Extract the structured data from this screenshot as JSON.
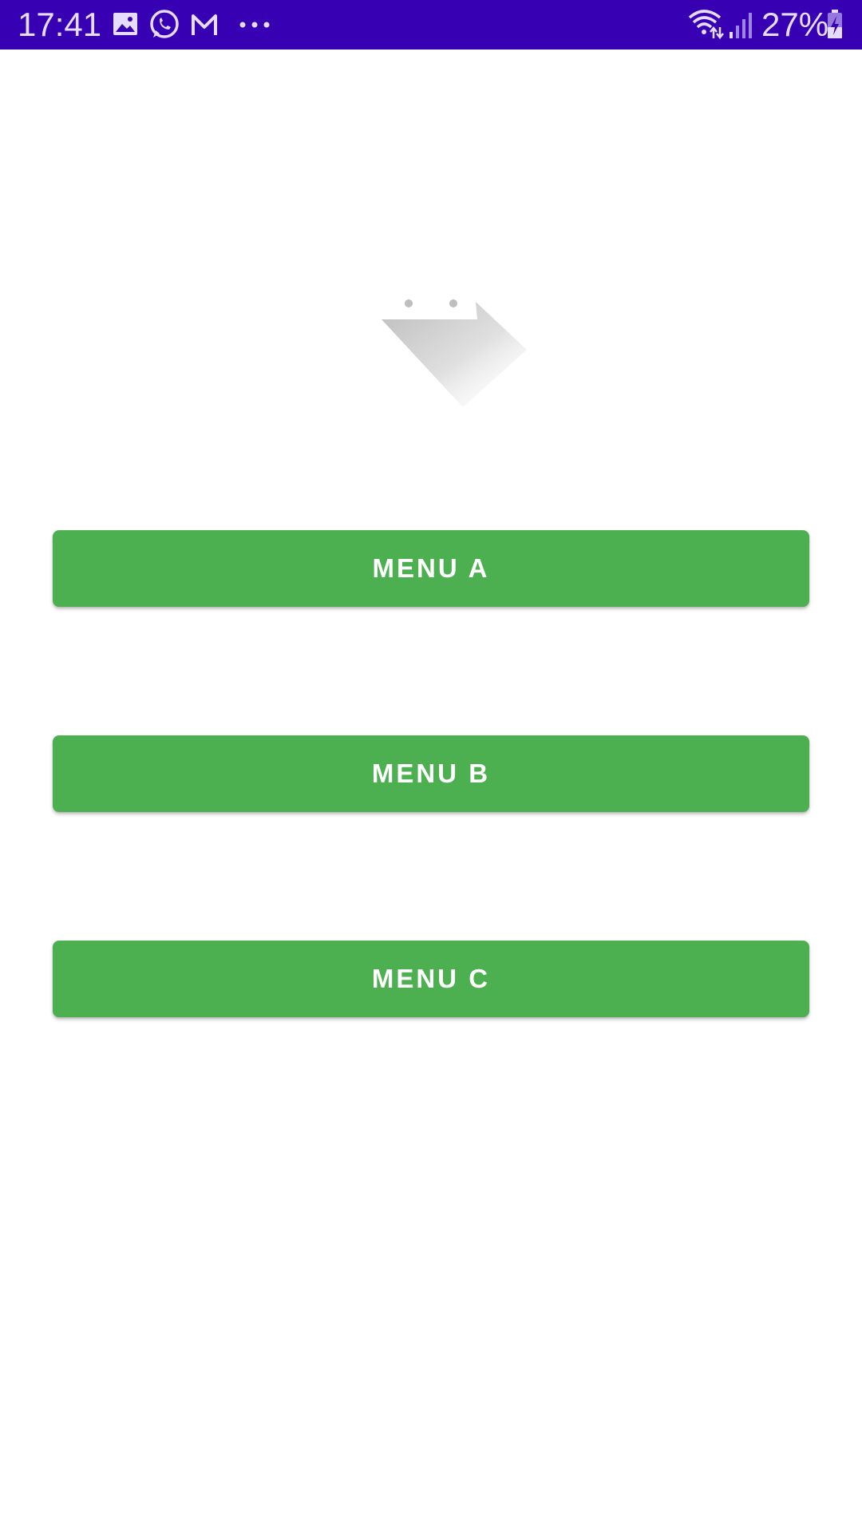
{
  "status_bar": {
    "time": "17:41",
    "battery_percent": "27%",
    "background_color": "#3700b3",
    "left_icons": [
      "image-icon",
      "whatsapp-icon",
      "gmail-icon",
      "more-dots-icon"
    ],
    "right_icons": [
      "wifi-icon",
      "signal-icon",
      "battery-charging-icon"
    ]
  },
  "logo": {
    "icon": "app-logo-icon"
  },
  "menu": {
    "button_color": "#4caf50",
    "items": [
      {
        "label": "MENU A"
      },
      {
        "label": "MENU B"
      },
      {
        "label": "MENU C"
      }
    ]
  }
}
